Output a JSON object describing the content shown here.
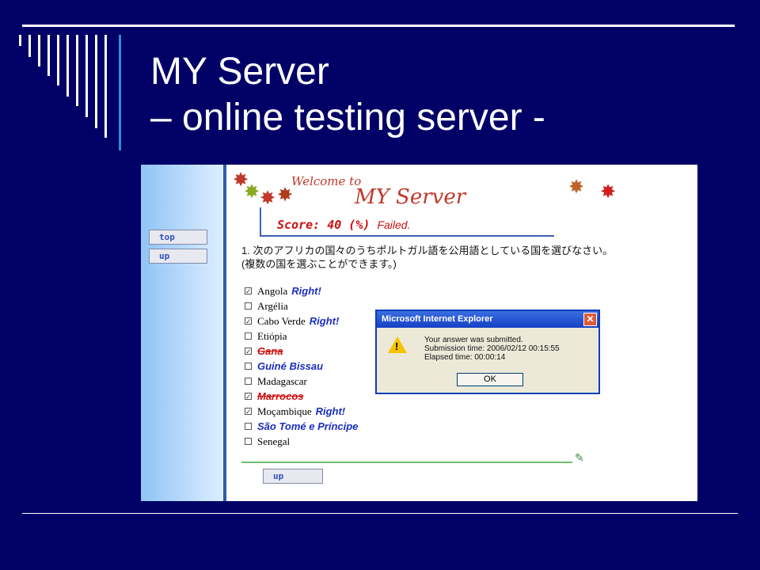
{
  "slide": {
    "title_line1": "MY Server",
    "title_line2": "–  online testing server -"
  },
  "left_nav": {
    "top_label": "top",
    "up_label": "up"
  },
  "banner": {
    "welcome_small": "Welcome to",
    "welcome_big": "MY Server"
  },
  "score": {
    "label": "Score: 40 (%)",
    "status": "Failed."
  },
  "question": {
    "line1": "1. 次のアフリカの国々のうちポルトガル語を公用語としている国を選びなさい。",
    "line2": "(複数の国を選ぶことができます。)"
  },
  "options": [
    {
      "name": "Angola",
      "checked": true,
      "mark": "Right!"
    },
    {
      "name": "Argélia",
      "checked": false,
      "mark": ""
    },
    {
      "name": "Cabo Verde",
      "checked": true,
      "mark": "Right!"
    },
    {
      "name": "Etiópia",
      "checked": false,
      "mark": ""
    },
    {
      "name": "Gana",
      "checked": true,
      "mark": ""
    },
    {
      "name": "Guiné Bissau",
      "checked": false,
      "mark": ""
    },
    {
      "name": "Madagascar",
      "checked": false,
      "mark": ""
    },
    {
      "name": "Marrocos",
      "checked": true,
      "mark": ""
    },
    {
      "name": "Moçambique",
      "checked": true,
      "mark": "Right!"
    },
    {
      "name": "São Tomé e Príncipe",
      "checked": false,
      "mark": ""
    },
    {
      "name": "Senegal",
      "checked": false,
      "mark": ""
    }
  ],
  "bottom_up_label": "up",
  "dialog": {
    "title": "Microsoft Internet Explorer",
    "line1": "Your answer was submitted.",
    "line2": "Submission time: 2006/02/12 00:15:55",
    "line3": "Elapsed time: 00:00:14",
    "ok_label": "OK"
  },
  "colors": {
    "background": "#000066",
    "right": "#1a2ec0",
    "wrong": "#cc1111"
  }
}
